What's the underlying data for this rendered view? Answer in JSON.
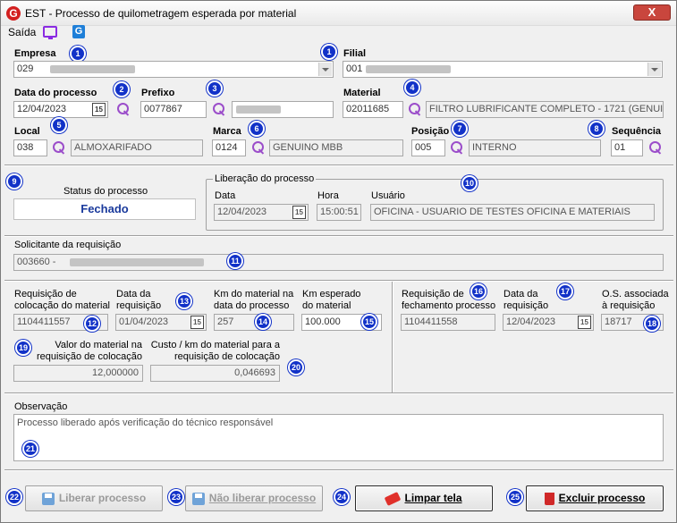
{
  "window": {
    "title": "EST - Processo de quilometragem esperada por material",
    "close": "X",
    "icon": "G"
  },
  "toolbar": {
    "saida": "Saída",
    "app_icon": "G"
  },
  "empresa": {
    "label": "Empresa",
    "value": "029"
  },
  "filial": {
    "label": "Filial",
    "value": "001"
  },
  "data_processo": {
    "label": "Data do processo",
    "value": "12/04/2023"
  },
  "prefixo": {
    "label": "Prefixo",
    "value": "0077867"
  },
  "material": {
    "label": "Material",
    "code": "02011685",
    "desc": "FILTRO LUBRIFICANTE COMPLETO - 1721 (GENUIN"
  },
  "local": {
    "label": "Local",
    "code": "038",
    "desc": "ALMOXARIFADO"
  },
  "marca": {
    "label": "Marca",
    "code": "0124",
    "desc": "GENUINO MBB"
  },
  "posicao": {
    "label": "Posição",
    "code": "005",
    "desc": "INTERNO"
  },
  "sequencia": {
    "label": "Sequência",
    "value": "01"
  },
  "status": {
    "label": "Status do processo",
    "value": "Fechado"
  },
  "liberacao": {
    "legend": "Liberação do processo",
    "data_label": "Data",
    "data": "12/04/2023",
    "hora_label": "Hora",
    "hora": "15:00:51",
    "usuario_label": "Usuário",
    "usuario": "OFICINA - USUARIO DE TESTES OFICINA E MATERIAIS"
  },
  "solicitante": {
    "label": "Solicitante da requisição",
    "value": "003660 -"
  },
  "req_colocacao": {
    "label1": "Requisição de",
    "label2": "colocação do material",
    "value": "1104411557"
  },
  "data_req": {
    "label1": "Data da",
    "label2": "requisição",
    "value": "01/04/2023"
  },
  "km_material": {
    "label1": "Km do material na",
    "label2": "data do processo",
    "value": "257"
  },
  "km_esperado": {
    "label1": "Km esperado",
    "label2": "do material",
    "value": "100.000"
  },
  "req_fechamento": {
    "label1": "Requisição de",
    "label2": "fechamento processo",
    "value": "1104411558"
  },
  "data_req2": {
    "label1": "Data da",
    "label2": "requisição",
    "value": "12/04/2023"
  },
  "os": {
    "label1": "O.S. associada",
    "label2": "à requisição",
    "value": "18717"
  },
  "valor_material": {
    "label1": "Valor do material na",
    "label2": "requisição de colocação",
    "value": "12,000000"
  },
  "custo_km": {
    "label1": "Custo / km do material para a",
    "label2": "requisição de colocação",
    "value": "0,046693"
  },
  "observacao": {
    "label": "Observação",
    "value": "Processo liberado após verificação do técnico responsável"
  },
  "buttons": {
    "liberar": "Liberar processo",
    "nao_liberar": "Não liberar processo",
    "limpar": "Limpar tela",
    "excluir": "Excluir processo"
  },
  "badges": [
    "1",
    "1",
    "2",
    "3",
    "4",
    "5",
    "6",
    "7",
    "8",
    "9",
    "10",
    "11",
    "12",
    "13",
    "14",
    "15",
    "16",
    "17",
    "18",
    "19",
    "20",
    "21",
    "22",
    "23",
    "24",
    "25"
  ],
  "calendar_glyph": "15"
}
